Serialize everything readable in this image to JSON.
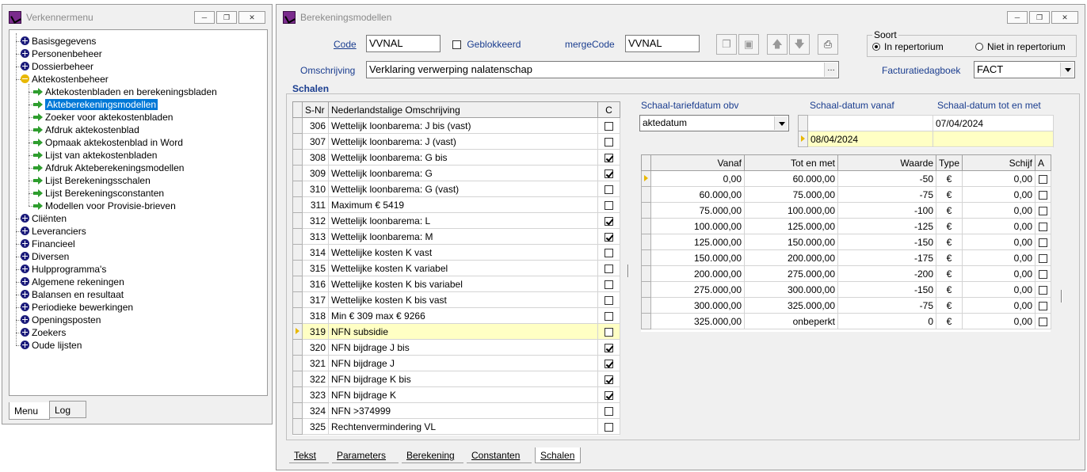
{
  "menu_window": {
    "title": "Verkennermenu",
    "tree": [
      {
        "label": "Basisgegevens",
        "level": 0,
        "icon": "plus"
      },
      {
        "label": "Personenbeheer",
        "level": 0,
        "icon": "plus"
      },
      {
        "label": "Dossierbeheer",
        "level": 0,
        "icon": "plus"
      },
      {
        "label": "Aktekostenbeheer",
        "level": 0,
        "icon": "minus"
      },
      {
        "label": "Aktekostenbladen en berekeningsbladen",
        "level": 1,
        "icon": "arrow"
      },
      {
        "label": "Akteberekeningsmodellen",
        "level": 1,
        "icon": "arrow",
        "selected": true
      },
      {
        "label": "Zoeker voor aktekostenbladen",
        "level": 1,
        "icon": "arrow"
      },
      {
        "label": "Afdruk aktekostenblad",
        "level": 1,
        "icon": "arrow"
      },
      {
        "label": "Opmaak aktekostenblad in Word",
        "level": 1,
        "icon": "arrow"
      },
      {
        "label": "Lijst van aktekostenbladen",
        "level": 1,
        "icon": "arrow"
      },
      {
        "label": "Afdruk Akteberekeningsmodellen",
        "level": 1,
        "icon": "arrow"
      },
      {
        "label": "Lijst Berekeningsschalen",
        "level": 1,
        "icon": "arrow"
      },
      {
        "label": "Lijst Berekeningsconstanten",
        "level": 1,
        "icon": "arrow"
      },
      {
        "label": "Modellen voor Provisie-brieven",
        "level": 1,
        "icon": "arrow"
      },
      {
        "label": "Cliënten",
        "level": 0,
        "icon": "plus"
      },
      {
        "label": "Leveranciers",
        "level": 0,
        "icon": "plus"
      },
      {
        "label": "Financieel",
        "level": 0,
        "icon": "plus"
      },
      {
        "label": "Diversen",
        "level": 0,
        "icon": "plus"
      },
      {
        "label": "Hulpprogramma's",
        "level": 0,
        "icon": "plus"
      },
      {
        "label": "Algemene rekeningen",
        "level": 0,
        "icon": "plus"
      },
      {
        "label": "Balansen en resultaat",
        "level": 0,
        "icon": "plus"
      },
      {
        "label": "Periodieke bewerkingen",
        "level": 0,
        "icon": "plus"
      },
      {
        "label": "Openingsposten",
        "level": 0,
        "icon": "plus"
      },
      {
        "label": "Zoekers",
        "level": 0,
        "icon": "plus"
      },
      {
        "label": "Oude lijsten",
        "level": 0,
        "icon": "plus"
      }
    ],
    "tabs": [
      "Menu",
      "Log"
    ],
    "active_tab": "Menu"
  },
  "main_window": {
    "title": "Berekeningsmodellen",
    "code_label": "Code",
    "code_value": "VVNAL",
    "geblokkeerd_label": "Geblokkeerd",
    "mergecode_label": "mergeCode",
    "mergecode_value": "VVNAL",
    "omschrijving_label": "Omschrijving",
    "omschrijving_value": "Verklaring verwerping nalatenschap",
    "soort_label": "Soort",
    "soort_options": [
      "In repertorium",
      "Niet in repertorium"
    ],
    "soort_selected": "In repertorium",
    "facturatie_label": "Facturatiedagboek",
    "facturatie_value": "FACT",
    "schalen_label": "Schalen",
    "schalen_table": {
      "headers": [
        "S-Nr",
        "Nederlandstalige Omschrijving",
        "C"
      ],
      "rows": [
        {
          "nr": "306",
          "desc": "Wettelijk loonbarema: J bis (vast)",
          "c": false
        },
        {
          "nr": "307",
          "desc": "Wettelijk loonbarema: J (vast)",
          "c": false
        },
        {
          "nr": "308",
          "desc": "Wettelijk loonbarema: G bis",
          "c": true
        },
        {
          "nr": "309",
          "desc": "Wettelijk loonbarema: G",
          "c": true
        },
        {
          "nr": "310",
          "desc": "Wettelijk loonbarema: G (vast)",
          "c": false
        },
        {
          "nr": "311",
          "desc": "Maximum € 5419",
          "c": false
        },
        {
          "nr": "312",
          "desc": "Wettelijk loonbarema: L",
          "c": true
        },
        {
          "nr": "313",
          "desc": "Wettelijk loonbarema: M",
          "c": true
        },
        {
          "nr": "314",
          "desc": "Wettelijke kosten K vast",
          "c": false
        },
        {
          "nr": "315",
          "desc": "Wettelijke kosten K variabel",
          "c": false
        },
        {
          "nr": "316",
          "desc": "Wettelijke kosten K bis variabel",
          "c": false
        },
        {
          "nr": "317",
          "desc": "Wettelijke kosten K bis vast",
          "c": false
        },
        {
          "nr": "318",
          "desc": "Min € 309 max € 9266",
          "c": false
        },
        {
          "nr": "319",
          "desc": "NFN subsidie",
          "c": false,
          "current": true
        },
        {
          "nr": "320",
          "desc": "NFN bijdrage J bis",
          "c": true
        },
        {
          "nr": "321",
          "desc": "NFN bijdrage J",
          "c": true
        },
        {
          "nr": "322",
          "desc": "NFN bijdrage K bis",
          "c": true
        },
        {
          "nr": "323",
          "desc": "NFN bijdrage K",
          "c": true
        },
        {
          "nr": "324",
          "desc": "NFN >374999",
          "c": false
        },
        {
          "nr": "325",
          "desc": "Rechtenvermindering VL",
          "c": false
        }
      ]
    },
    "tariefdatum_label": "Schaal-tariefdatum obv",
    "tariefdatum_value": "aktedatum",
    "datum_vanaf_label": "Schaal-datum vanaf",
    "datum_tot_label": "Schaal-datum tot en met",
    "datum_rows": [
      {
        "vanaf": "",
        "tot": "07/04/2024",
        "current": false
      },
      {
        "vanaf": "08/04/2024",
        "tot": "",
        "current": true
      }
    ],
    "bracket_table": {
      "headers": [
        "Vanaf",
        "Tot en met",
        "Waarde",
        "Type",
        "Schijf",
        "A"
      ],
      "rows": [
        {
          "vanaf": "0,00",
          "tot": "60.000,00",
          "waarde": "-50",
          "type": "€",
          "schijf": "0,00",
          "a": false,
          "current": true
        },
        {
          "vanaf": "60.000,00",
          "tot": "75.000,00",
          "waarde": "-75",
          "type": "€",
          "schijf": "0,00",
          "a": false
        },
        {
          "vanaf": "75.000,00",
          "tot": "100.000,00",
          "waarde": "-100",
          "type": "€",
          "schijf": "0,00",
          "a": false
        },
        {
          "vanaf": "100.000,00",
          "tot": "125.000,00",
          "waarde": "-125",
          "type": "€",
          "schijf": "0,00",
          "a": false
        },
        {
          "vanaf": "125.000,00",
          "tot": "150.000,00",
          "waarde": "-150",
          "type": "€",
          "schijf": "0,00",
          "a": false
        },
        {
          "vanaf": "150.000,00",
          "tot": "200.000,00",
          "waarde": "-175",
          "type": "€",
          "schijf": "0,00",
          "a": false
        },
        {
          "vanaf": "200.000,00",
          "tot": "275.000,00",
          "waarde": "-200",
          "type": "€",
          "schijf": "0,00",
          "a": false
        },
        {
          "vanaf": "275.000,00",
          "tot": "300.000,00",
          "waarde": "-150",
          "type": "€",
          "schijf": "0,00",
          "a": false
        },
        {
          "vanaf": "300.000,00",
          "tot": "325.000,00",
          "waarde": "-75",
          "type": "€",
          "schijf": "0,00",
          "a": false
        },
        {
          "vanaf": "325.000,00",
          "tot": "onbeperkt",
          "waarde": "0",
          "type": "€",
          "schijf": "0,00",
          "a": false
        }
      ]
    },
    "bottom_tabs": [
      "Tekst",
      "Parameters",
      "Berekening",
      "Constanten",
      "Schalen"
    ],
    "active_bottom_tab": "Schalen"
  },
  "colors": {
    "label_blue": "#1a3d8f",
    "selection_blue": "#0078d7",
    "current_row_yellow": "#ffffc4",
    "tree_plus_icon": "#1a1a7a",
    "tree_minus_icon": "#e8b800",
    "tree_arrow_icon": "#2e9e2e"
  },
  "icons": {
    "app": "app-pen-icon",
    "toolbar": [
      "copy-icon",
      "paste-icon",
      "move-up-icon",
      "move-down-icon",
      "print-icon"
    ]
  }
}
